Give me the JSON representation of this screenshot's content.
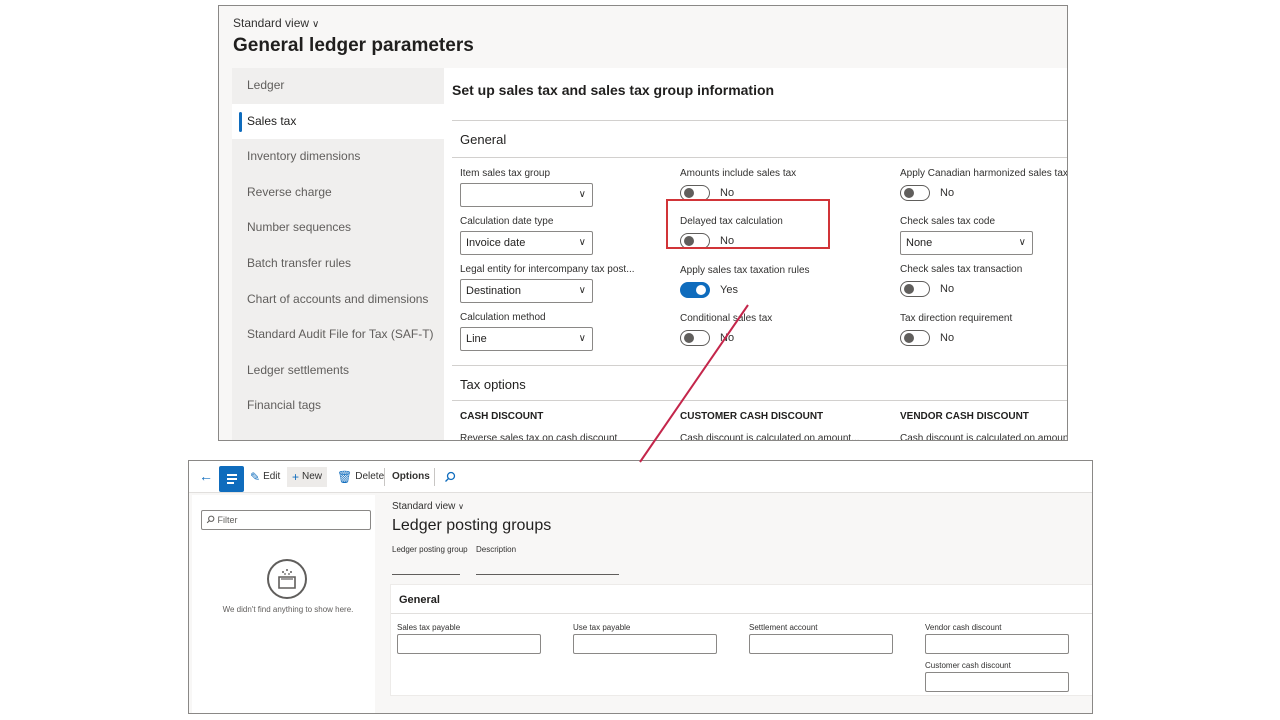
{
  "top": {
    "view_label": "Standard view",
    "title": "General ledger parameters",
    "nav": [
      {
        "label": "Ledger",
        "active": false
      },
      {
        "label": "Sales tax",
        "active": true
      },
      {
        "label": "Inventory dimensions",
        "active": false
      },
      {
        "label": "Reverse charge",
        "active": false
      },
      {
        "label": "Number sequences",
        "active": false
      },
      {
        "label": "Batch transfer rules",
        "active": false
      },
      {
        "label": "Chart of accounts and dimensions",
        "active": false
      },
      {
        "label": "Standard Audit File for Tax (SAF-T)",
        "active": false
      },
      {
        "label": "Ledger settlements",
        "active": false
      },
      {
        "label": "Financial tags",
        "active": false
      }
    ],
    "panel_heading": "Set up sales tax and sales tax group information",
    "general_title": "General",
    "fields": {
      "item_sales_tax_group": {
        "label": "Item sales tax group",
        "value": ""
      },
      "calculation_date_type": {
        "label": "Calculation date type",
        "value": "Invoice date"
      },
      "legal_entity": {
        "label": "Legal entity for intercompany tax post...",
        "value": "Destination"
      },
      "calculation_method": {
        "label": "Calculation method",
        "value": "Line"
      },
      "amounts_include": {
        "label": "Amounts include sales tax",
        "state": "No"
      },
      "delayed_tax": {
        "label": "Delayed tax calculation",
        "state": "No"
      },
      "apply_taxation_rules": {
        "label": "Apply sales tax taxation rules",
        "state": "Yes"
      },
      "conditional": {
        "label": "Conditional sales tax",
        "state": "No"
      },
      "canadian": {
        "label": "Apply Canadian harmonized sales tax",
        "state": "No"
      },
      "check_code": {
        "label": "Check sales tax code",
        "value": "None"
      },
      "check_transaction": {
        "label": "Check sales tax transaction",
        "state": "No"
      },
      "tax_direction": {
        "label": "Tax direction requirement",
        "state": "No"
      }
    },
    "tax_options_title": "Tax options",
    "cash_discount": {
      "heading": "CASH DISCOUNT",
      "cut_label": "Reverse sales tax on cash discount"
    },
    "customer_cash_discount": {
      "heading": "CUSTOMER CASH DISCOUNT",
      "cut_label": "Cash discount is calculated on amount..."
    },
    "vendor_cash_discount": {
      "heading": "VENDOR CASH DISCOUNT",
      "cut_label": "Cash discount is calculated on amount"
    }
  },
  "bottom": {
    "toolbar": {
      "edit": "Edit",
      "new": "New",
      "delete": "Delete",
      "options": "Options"
    },
    "filter_placeholder": "Filter",
    "empty_text": "We didn't find anything to show here.",
    "view_label": "Standard view",
    "title": "Ledger posting groups",
    "columns": [
      "Ledger posting group",
      "Description"
    ],
    "general_title": "General",
    "fields": {
      "sales_tax_payable": "Sales tax payable",
      "use_tax_payable": "Use tax payable",
      "settlement_account": "Settlement account",
      "vendor_cash_discount": "Vendor cash discount",
      "customer_cash_discount": "Customer cash discount"
    }
  },
  "colors": {
    "accent": "#0f6cbd",
    "highlight": "#d13438",
    "connector": "#c4264b"
  }
}
